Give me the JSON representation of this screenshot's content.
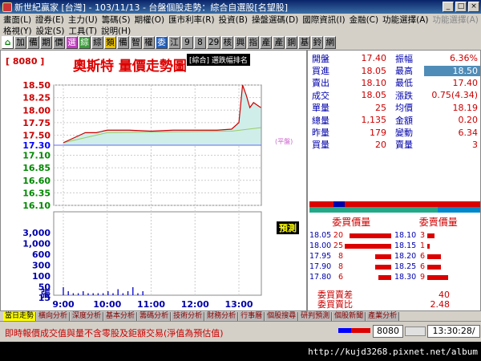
{
  "window": {
    "title": "新世紀贏家 [台灣] - 103/11/13 - 台盤個股走勢：綜合自選股[名望股]"
  },
  "menu1": [
    "畫面(L)",
    "證券(E)",
    "主力(U)",
    "籌碼(S)",
    "期權(O)",
    "匯市利率(R)",
    "投資(B)",
    "操盤選碼(D)",
    "國際資訊(I)",
    "金融(C)",
    "功能選擇(A)",
    "功能選擇(A)"
  ],
  "menu2": [
    "格視(Y)",
    "設定(S)",
    "工具(T)",
    "說明(H)"
  ],
  "toolbar": [
    "加",
    "備",
    "期",
    "價",
    "選",
    "綜",
    "綜",
    "類",
    "備",
    "智",
    "權",
    "委",
    "江",
    "9",
    "8",
    "29",
    "核",
    "興",
    "指",
    "產",
    "產",
    "鋼",
    "基",
    "鈴",
    "網"
  ],
  "chart": {
    "code": "[ 8080 ]",
    "name": "奧斯特  量價走勢圖",
    "tag": "[綜合] 選跌幅排名",
    "price_labels": [
      "18.50",
      "18.25",
      "18.00",
      "17.75",
      "17.50",
      "17.30",
      "17.10",
      "16.85",
      "16.60",
      "16.35",
      "16.10"
    ],
    "volume_labels": [
      "3,000",
      "1,000",
      "600",
      "300",
      "100",
      "50",
      "15"
    ],
    "volume_unit": "張",
    "time_labels": [
      "9:00",
      "10:00",
      "11:00",
      "12:00",
      "13:00"
    ],
    "ref_label": "(平盤)",
    "forecast": "預測"
  },
  "chart_data": {
    "type": "line",
    "x": [
      "9:00",
      "9:15",
      "9:30",
      "9:45",
      "10:00",
      "10:30",
      "11:00",
      "11:30",
      "12:00",
      "12:30",
      "12:50",
      "13:00",
      "13:05",
      "13:10",
      "13:15",
      "13:20",
      "13:25",
      "13:30"
    ],
    "series": [
      {
        "values": [
          17.35,
          17.45,
          17.55,
          17.55,
          17.6,
          17.6,
          17.58,
          17.6,
          17.6,
          17.6,
          17.62,
          17.75,
          18.5,
          18.3,
          18.05,
          18.15,
          18.1,
          18.05
        ]
      }
    ],
    "reference_price": 17.3,
    "ylim": [
      16.1,
      18.5
    ],
    "volume_ylim": [
      0,
      3000
    ]
  },
  "quote": [
    {
      "l1": "開盤",
      "v1": "17.40",
      "c1": "up",
      "l2": "振幅",
      "v2": "6.36%",
      "c2": "up"
    },
    {
      "l1": "買進",
      "v1": "18.05",
      "c1": "up",
      "l2": "最高",
      "v2": "18.50",
      "c2": "hl"
    },
    {
      "l1": "賣出",
      "v1": "18.10",
      "c1": "up",
      "l2": "最低",
      "v2": "17.40",
      "c2": "up"
    },
    {
      "l1": "成交",
      "v1": "18.05",
      "c1": "up",
      "l2": "漲跌",
      "v2": "0.75(4.34)",
      "c2": "up"
    },
    {
      "l1": "單量",
      "v1": "25",
      "c1": "up",
      "l2": "均價",
      "v2": "18.19",
      "c2": "up"
    },
    {
      "l1": "總量",
      "v1": "1,135",
      "c1": "up",
      "l2": "金額",
      "v2": "0.20",
      "c2": "up"
    },
    {
      "l1": "昨量",
      "v1": "179",
      "c1": "up",
      "l2": "變動",
      "v2": "6.34",
      "c2": "up"
    },
    {
      "l1": "買量",
      "v1": "20",
      "c1": "up",
      "l2": "賣量",
      "v2": "3",
      "c2": "up"
    }
  ],
  "orderbook": {
    "buy_header": "委買價量",
    "sell_header": "委賣價量",
    "rows": [
      {
        "bp": "18.05",
        "bq": "20",
        "bf": 0.9,
        "sp": "18.10",
        "sq": "3",
        "sf": 0.15
      },
      {
        "bp": "18.00",
        "bq": "25",
        "bf": 1.0,
        "sp": "18.15",
        "sq": "1",
        "sf": 0.05
      },
      {
        "bp": "17.95",
        "bq": "8",
        "bf": 0.35,
        "sp": "18.20",
        "sq": "6",
        "sf": 0.3
      },
      {
        "bp": "17.90",
        "bq": "8",
        "bf": 0.35,
        "sp": "18.25",
        "sq": "6",
        "sf": 0.3
      },
      {
        "bp": "17.80",
        "bq": "6",
        "bf": 0.28,
        "sp": "18.30",
        "sq": "9",
        "sf": 0.45
      }
    ]
  },
  "diff": [
    {
      "label": "委買賣差",
      "value": "40"
    },
    {
      "label": "委買賣比",
      "value": "2.48"
    }
  ],
  "tabs": [
    "當日走勢",
    "橫向分析",
    "深度分析",
    "基本分析",
    "籌碼分析",
    "技術分析",
    "財務分析",
    "行事曆",
    "個股搜尋",
    "研判預測",
    "個股新聞",
    "產業分析"
  ],
  "status": {
    "message": "即時報價成交值與量不含零股及鉅額交易(淨值為預估值)",
    "code": "8080",
    "time": "13:30:28/"
  },
  "watermark": "http://kujd3268.pixnet.net/album"
}
